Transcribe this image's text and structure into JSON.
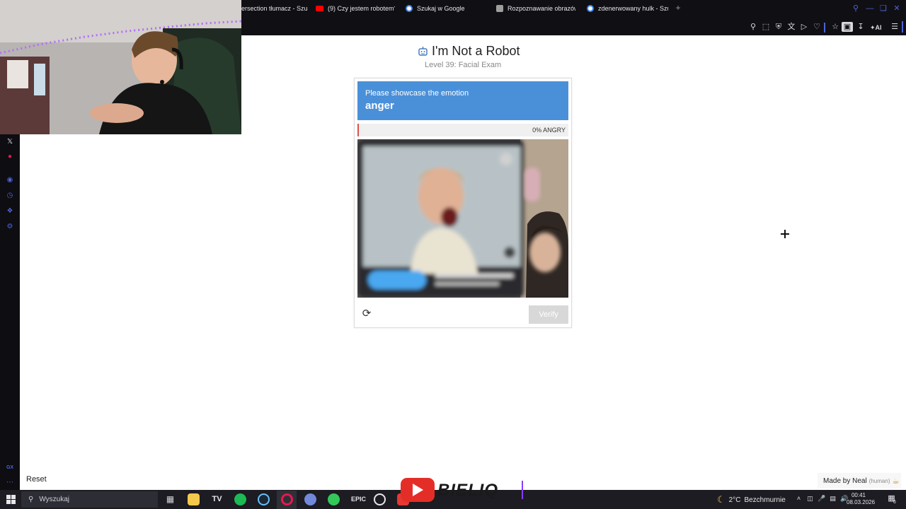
{
  "browser": {
    "tabs": [
      {
        "label": "ersection tłumacz - Szu",
        "favicon_color": "#e53935"
      },
      {
        "label": "(9) Czy jestem robotem? I",
        "favicon_color": "#ff0000"
      },
      {
        "label": "Szukaj w Google",
        "favicon_color": "#4285f4"
      },
      {
        "label": "Rozpoznawanie obrazów",
        "favicon_color": "#9e9e9e"
      },
      {
        "label": "zdenerwowany hulk - Szu",
        "favicon_color": "#4285f4"
      }
    ],
    "new_tab_icon": "plus-icon",
    "toolbar_icons": [
      "pin-icon",
      "snapshot-icon",
      "shield-icon",
      "translate-icon",
      "send-icon",
      "heart-icon",
      "extensions-icon",
      "camera-icon",
      "download-icon"
    ],
    "ai_label": "AI",
    "accent_color": "#4e63d9"
  },
  "page": {
    "title": "I'm Not a Robot",
    "level": "Level 39: Facial Exam"
  },
  "captcha": {
    "prompt": "Please showcase the emotion",
    "emotion": "anger",
    "meter_text": "0% ANGRY",
    "meter_value": 0,
    "verify_label": "Verify",
    "prompt_color": "#4a90d9",
    "meter_color": "#d9534f"
  },
  "bottom": {
    "reset_label": "Reset",
    "made_by": "Made by Neal",
    "made_by_note": "(human)"
  },
  "overlay": {
    "channel_name": "BIELIQ"
  },
  "taskbar": {
    "search_placeholder": "Wyszukaj",
    "weather_temp": "2°C",
    "weather_desc": "Bezchmurnie",
    "time": "00:41",
    "date": "08.03.2026",
    "notification_count": "6",
    "apps": [
      {
        "name": "task-view",
        "color": "#cfcfd6"
      },
      {
        "name": "file-explorer",
        "color": "#f2c94c"
      },
      {
        "name": "tradingview",
        "color": "#e6e6ea"
      },
      {
        "name": "spotify",
        "color": "#1db954"
      },
      {
        "name": "steam",
        "color": "#66c0f4"
      },
      {
        "name": "opera-gx",
        "color": "#e5194e"
      },
      {
        "name": "discord",
        "color": "#7289da"
      },
      {
        "name": "app-green",
        "color": "#34c759"
      },
      {
        "name": "app-epic",
        "color": "#e6e6ea"
      },
      {
        "name": "app-speed",
        "color": "#e6e6ea"
      },
      {
        "name": "app-red",
        "color": "#e53935"
      }
    ]
  }
}
